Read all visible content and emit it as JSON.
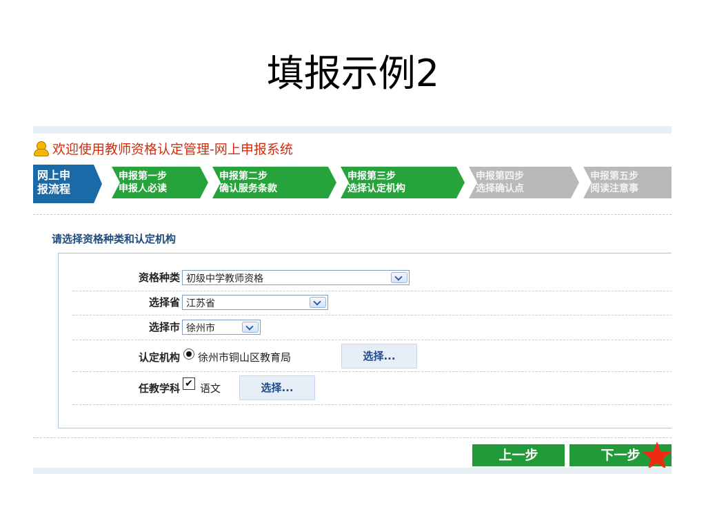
{
  "slide": {
    "title": "填报示例2"
  },
  "header": {
    "welcome": "欢迎使用教师资格认定管理-网上申报系统",
    "accent": "#d22c0e"
  },
  "steps": {
    "current": {
      "line1": "网上申",
      "line2": "报流程"
    },
    "items": [
      {
        "line1": "申报第一步",
        "line2": "申报人必读",
        "state": "done"
      },
      {
        "line1": "申报第二步",
        "line2": "确认服务条款",
        "state": "done"
      },
      {
        "line1": "申报第三步",
        "line2": "选择认定机构",
        "state": "active"
      },
      {
        "line1": "申报第四步",
        "line2": "选择确认点",
        "state": "pending"
      },
      {
        "line1": "申报第五步",
        "line2": "阅读注意事",
        "state": "pending"
      }
    ]
  },
  "form": {
    "section_title": "请选择资格种类和认定机构",
    "rows": {
      "qualification": {
        "label": "资格种类",
        "value": "初级中学教师资格"
      },
      "province": {
        "label": "选择省",
        "value": "江苏省"
      },
      "city": {
        "label": "选择市",
        "value": "徐州市"
      },
      "institution": {
        "label": "认定机构",
        "value": "徐州市铜山区教育局",
        "button": "选择..."
      },
      "subject": {
        "label": "任教学科",
        "value": "语文",
        "button": "选择..."
      }
    }
  },
  "nav": {
    "prev": "上一步",
    "next": "下一步"
  },
  "colors": {
    "green": "#26a33a",
    "grey": "#b9b9b9",
    "blue": "#1b6aa8",
    "star": "#ee2a12"
  }
}
